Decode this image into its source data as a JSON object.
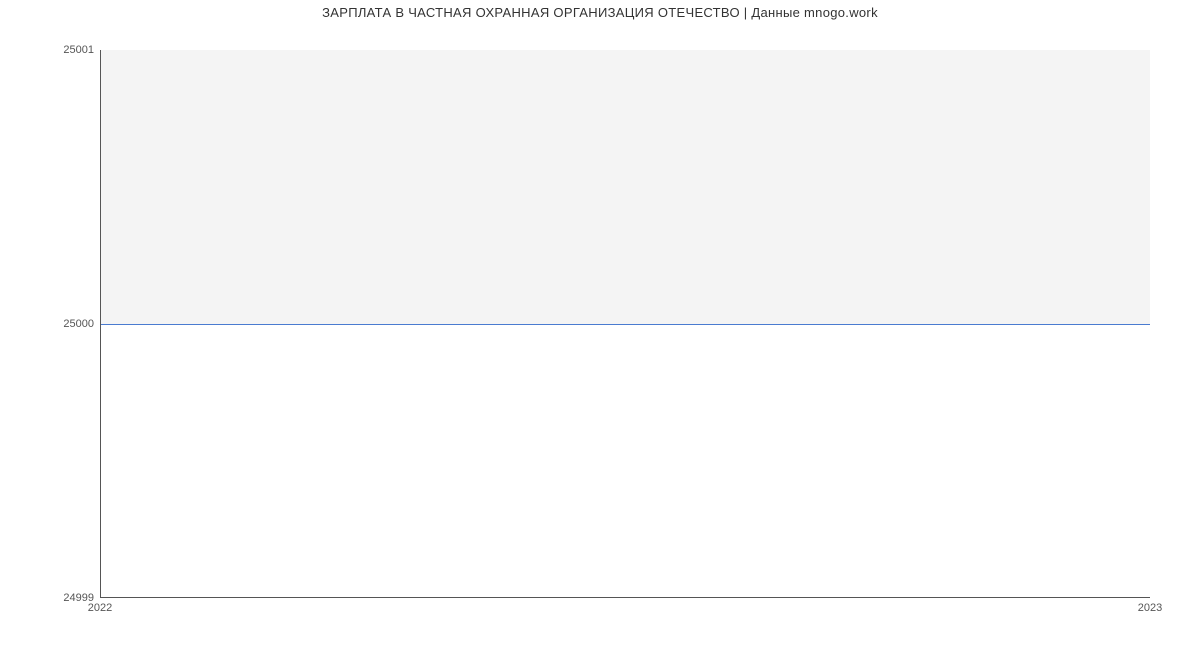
{
  "chart_data": {
    "type": "line",
    "title": "ЗАРПЛАТА В  ЧАСТНАЯ ОХРАННАЯ ОРГАНИЗАЦИЯ ОТЕЧЕСТВО | Данные mnogo.work",
    "xlabel": "",
    "ylabel": "",
    "x": [
      2022,
      2023
    ],
    "y": [
      25000,
      25000
    ],
    "x_ticks": [
      "2022",
      "2023"
    ],
    "y_ticks": [
      "24999",
      "25000",
      "25001"
    ],
    "ylim": [
      24999,
      25001
    ],
    "xlim": [
      2022,
      2023
    ],
    "line_color": "#4a7bd0",
    "shade_color": "#f4f4f4"
  }
}
